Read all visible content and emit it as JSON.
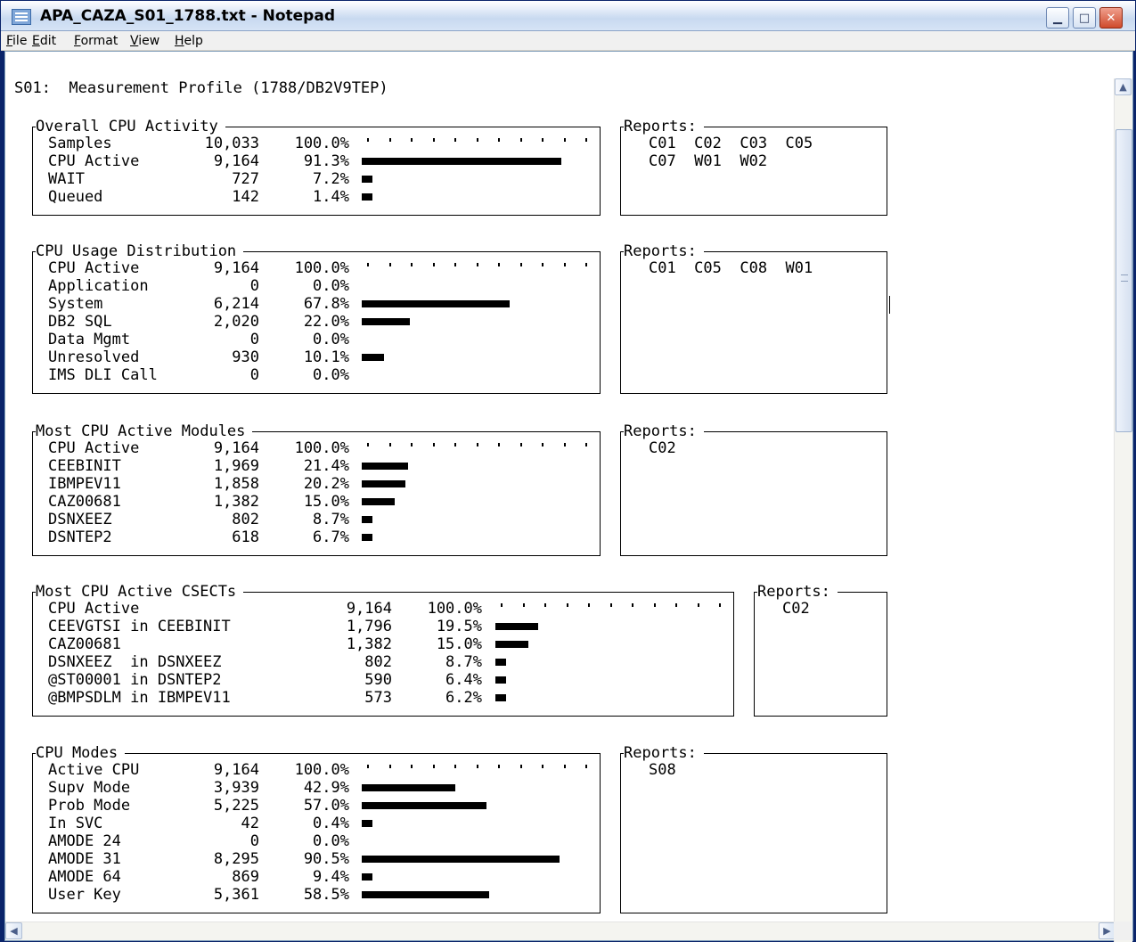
{
  "window": {
    "title": "APA_CAZA_S01_1788.txt - Notepad"
  },
  "menu": [
    "File",
    "Edit",
    "Format",
    "View",
    "Help"
  ],
  "header_line": "S01:  Measurement Profile (1788/DB2V9TEP)",
  "sections": [
    {
      "title": "Overall CPU Activity",
      "rows": [
        [
          "Samples",
          "10,033",
          "100.0%",
          0
        ],
        [
          "CPU Active",
          "9,164",
          "91.3%",
          91.3
        ],
        [
          "WAIT",
          "727",
          "7.2%",
          2
        ],
        [
          "Queued",
          "142",
          "1.4%",
          2
        ]
      ],
      "reports": [
        "C01  C02  C03  C05",
        "C07  W01  W02"
      ]
    },
    {
      "title": "CPU Usage Distribution",
      "rows": [
        [
          "CPU Active",
          "9,164",
          "100.0%",
          0
        ],
        [
          "Application",
          "0",
          "0.0%",
          0
        ],
        [
          "System",
          "6,214",
          "67.8%",
          67.8
        ],
        [
          "DB2 SQL",
          "2,020",
          "22.0%",
          22
        ],
        [
          "Data Mgmt",
          "0",
          "0.0%",
          0
        ],
        [
          "Unresolved",
          "930",
          "10.1%",
          10.1
        ],
        [
          "IMS DLI Call",
          "0",
          "0.0%",
          0
        ]
      ],
      "reports": [
        "C01  C05  C08  W01"
      ]
    },
    {
      "title": "Most CPU Active Modules",
      "rows": [
        [
          "CEEBINIT",
          "1,969",
          "21.4%",
          21.4
        ],
        [
          "IBMPEV11",
          "1,858",
          "20.2%",
          20.2
        ],
        [
          "CAZ00681",
          "1,382",
          "15.0%",
          15
        ],
        [
          "DSNXEEZ",
          "802",
          "8.7%",
          3
        ],
        [
          "DSNTEP2",
          "618",
          "6.7%",
          3
        ]
      ],
      "lead": [
        "CPU Active",
        "9,164",
        "100.0%"
      ],
      "reports": [
        "C02"
      ]
    },
    {
      "title": "Most CPU Active CSECTs",
      "rows": [
        [
          "CEEVGTSI in CEEBINIT",
          "1,796",
          "19.5%",
          19.5
        ],
        [
          "CAZ00681",
          "1,382",
          "15.0%",
          15
        ],
        [
          "DSNXEEZ  in DSNXEEZ",
          "802",
          "8.7%",
          3
        ],
        [
          "@ST00001 in DSNTEP2",
          "590",
          "6.4%",
          3
        ],
        [
          "@BMPSDLM in IBMPEV11",
          "573",
          "6.2%",
          3
        ]
      ],
      "lead": [
        "CPU Active",
        "9,164",
        "100.0%"
      ],
      "reports": [
        "C02"
      ]
    },
    {
      "title": "CPU Modes",
      "rows": [
        [
          "Supv Mode",
          "3,939",
          "42.9%",
          42.9
        ],
        [
          "Prob Mode",
          "5,225",
          "57.0%",
          57
        ],
        [
          "In SVC",
          "42",
          "0.4%",
          2
        ],
        [
          "AMODE 24",
          "0",
          "0.0%",
          0
        ],
        [
          "AMODE 31",
          "8,295",
          "90.5%",
          90.5
        ],
        [
          "AMODE 64",
          "869",
          "9.4%",
          2
        ],
        [
          "User Key",
          "5,361",
          "58.5%",
          58.5
        ]
      ],
      "lead": [
        "Active CPU",
        "9,164",
        "100.0%"
      ],
      "reports": [
        "S08"
      ]
    }
  ],
  "labels": {
    "reports": "Reports:"
  }
}
